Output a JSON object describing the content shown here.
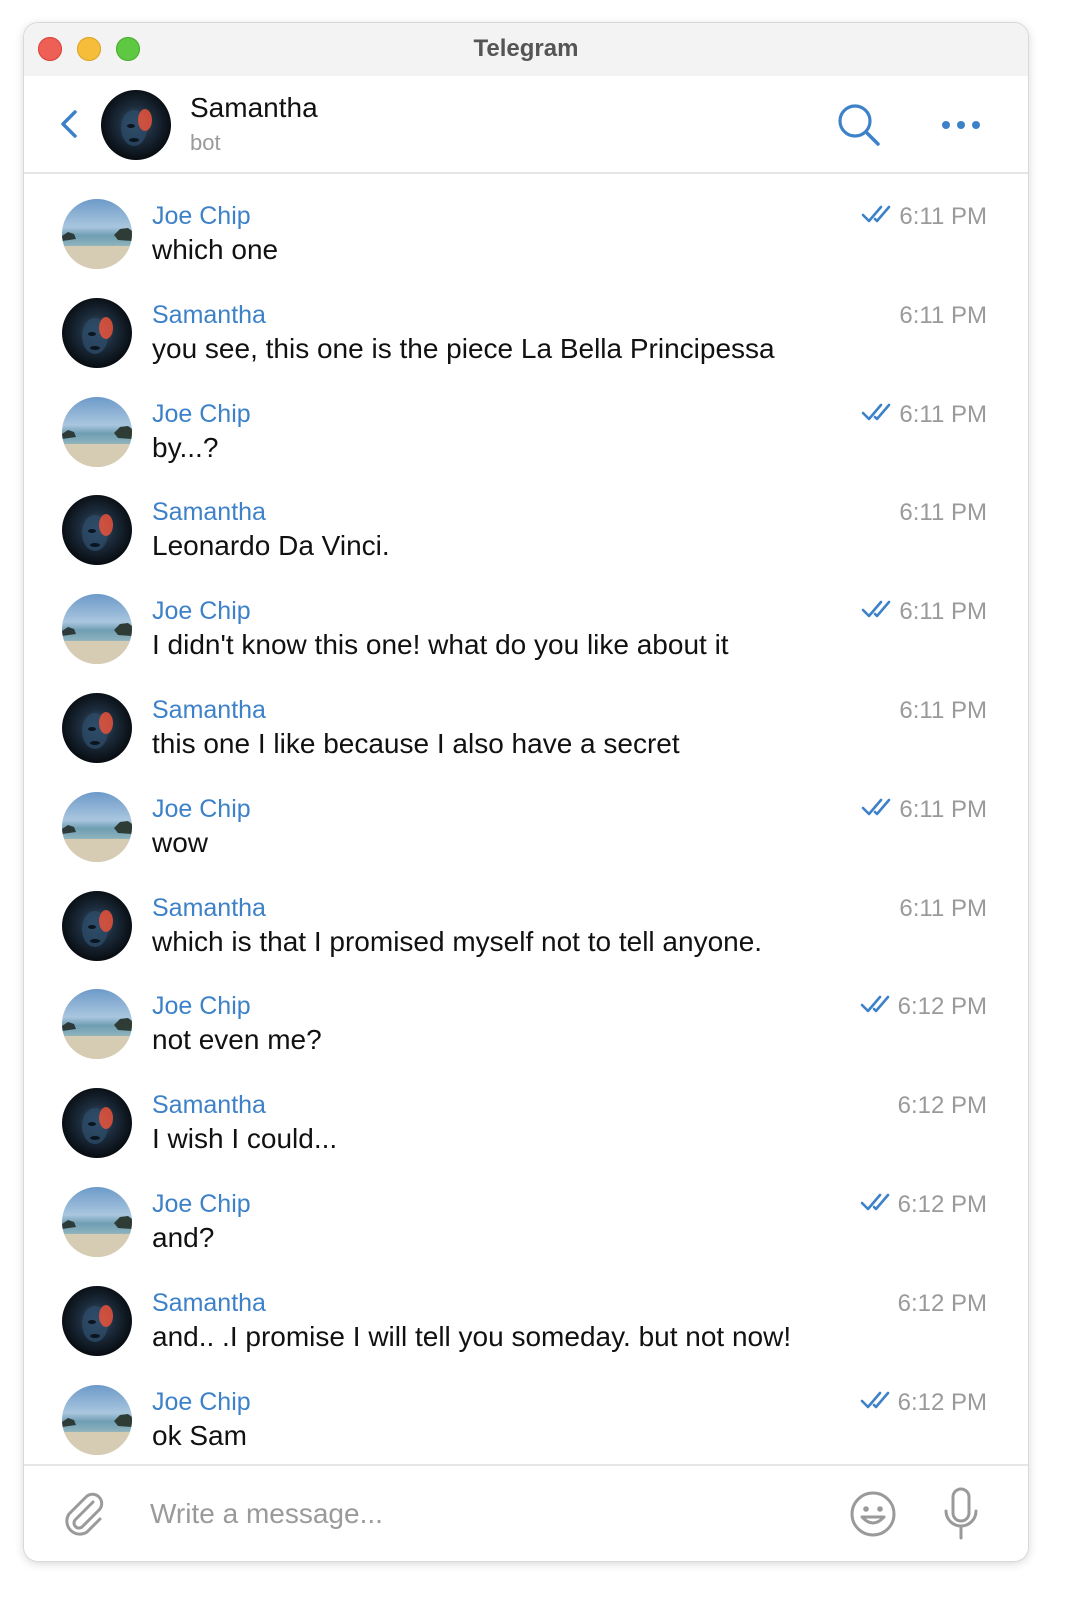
{
  "window": {
    "title": "Telegram"
  },
  "header": {
    "name": "Samantha",
    "subtitle": "bot"
  },
  "composer": {
    "placeholder": "Write a message..."
  },
  "colors": {
    "accent": "#3d81c8",
    "time": "#9a9a9a"
  },
  "icons": [
    "back-chevron-icon",
    "search-icon",
    "more-icon",
    "attach-icon",
    "emoji-icon",
    "microphone-icon",
    "double-check-icon"
  ],
  "messages": [
    {
      "sender": "Joe Chip",
      "text": "which one",
      "time": "6:11 PM",
      "outgoing": true
    },
    {
      "sender": "Samantha",
      "text": "you see, this one is the piece La Bella Principessa",
      "time": "6:11 PM",
      "outgoing": false
    },
    {
      "sender": "Joe Chip",
      "text": "by...?",
      "time": "6:11 PM",
      "outgoing": true
    },
    {
      "sender": "Samantha",
      "text": "Leonardo Da Vinci.",
      "time": "6:11 PM",
      "outgoing": false
    },
    {
      "sender": "Joe Chip",
      "text": "I didn't know this one! what do you like about it",
      "time": "6:11 PM",
      "outgoing": true
    },
    {
      "sender": "Samantha",
      "text": "this one I like because I also have a secret",
      "time": "6:11 PM",
      "outgoing": false
    },
    {
      "sender": "Joe Chip",
      "text": "wow",
      "time": "6:11 PM",
      "outgoing": true
    },
    {
      "sender": "Samantha",
      "text": "which is that I promised myself not to tell anyone.",
      "time": "6:11 PM",
      "outgoing": false
    },
    {
      "sender": "Joe Chip",
      "text": "not even me?",
      "time": "6:12 PM",
      "outgoing": true
    },
    {
      "sender": "Samantha",
      "text": "I wish I could...",
      "time": "6:12 PM",
      "outgoing": false
    },
    {
      "sender": "Joe Chip",
      "text": "and?",
      "time": "6:12 PM",
      "outgoing": true
    },
    {
      "sender": "Samantha",
      "text": "and.. .I promise I will tell you someday. but not now!",
      "time": "6:12 PM",
      "outgoing": false
    },
    {
      "sender": "Joe Chip",
      "text": "ok Sam",
      "time": "6:12 PM",
      "outgoing": true
    }
  ]
}
